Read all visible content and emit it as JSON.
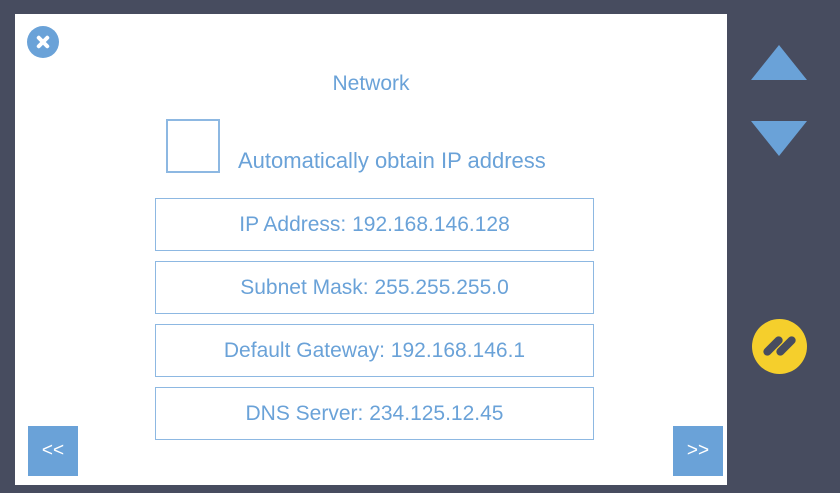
{
  "dialog": {
    "title": "Network",
    "auto_ip_label": "Automatically obtain IP address",
    "auto_ip_checked": false,
    "fields": [
      "IP Address: 192.168.146.128",
      "Subnet Mask: 255.255.255.0",
      "Default Gateway: 192.168.146.1",
      "DNS Server: 234.125.12.45"
    ]
  },
  "nav": {
    "prev_label": "<<",
    "next_label": ">>"
  },
  "icons": {
    "close": "close-icon",
    "scroll_up": "triangle-up-icon",
    "scroll_down": "triangle-down-icon",
    "edit": "edit-icon"
  },
  "colors": {
    "background": "#474c5f",
    "panel": "#ffffff",
    "accent": "#6aa2d8",
    "edit": "#f5cf2c"
  }
}
